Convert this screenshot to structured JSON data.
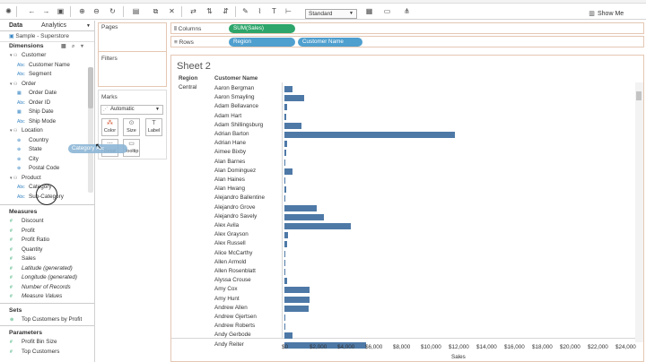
{
  "toolbar": {
    "icons": [
      "back-icon",
      "forward-icon",
      "save-icon",
      "new-datasource-icon",
      "pause-icon",
      "refresh-icon",
      "new-sheet-icon",
      "duplicate-icon",
      "clear-icon",
      "swap-icon",
      "sort-asc-icon",
      "sort-desc-icon",
      "highlight-icon",
      "group-icon",
      "label-icon",
      "fix-axes-icon",
      "fit-icon",
      "presentation-icon",
      "share-icon"
    ],
    "standard_label": "Standard",
    "show_me_label": "Show Me"
  },
  "left": {
    "tabs": {
      "data": "Data",
      "analytics": "Analytics"
    },
    "datasource": "Sample - Superstore",
    "dimensions_title": "Dimensions",
    "dimensions": [
      {
        "label": "Customer",
        "type": "folder"
      },
      {
        "label": "Customer Name",
        "type": "abc"
      },
      {
        "label": "Segment",
        "type": "abc"
      },
      {
        "label": "Order",
        "type": "folder"
      },
      {
        "label": "Order Date",
        "type": "date"
      },
      {
        "label": "Order ID",
        "type": "abc"
      },
      {
        "label": "Ship Date",
        "type": "date"
      },
      {
        "label": "Ship Mode",
        "type": "abc"
      },
      {
        "label": "Location",
        "type": "folder"
      },
      {
        "label": "Country",
        "type": "geo"
      },
      {
        "label": "State",
        "type": "geo"
      },
      {
        "label": "City",
        "type": "geo"
      },
      {
        "label": "Postal Code",
        "type": "geo"
      },
      {
        "label": "Product",
        "type": "folder"
      },
      {
        "label": "Category",
        "type": "abc"
      },
      {
        "label": "Sub-Category",
        "type": "abc"
      }
    ],
    "measures_title": "Measures",
    "measures": [
      {
        "label": "Discount",
        "italic": false
      },
      {
        "label": "Profit",
        "italic": false
      },
      {
        "label": "Profit Ratio",
        "italic": false
      },
      {
        "label": "Quantity",
        "italic": false
      },
      {
        "label": "Sales",
        "italic": false
      },
      {
        "label": "Latitude (generated)",
        "italic": true
      },
      {
        "label": "Longitude (generated)",
        "italic": true
      },
      {
        "label": "Number of Records",
        "italic": true
      },
      {
        "label": "Measure Values",
        "italic": true
      }
    ],
    "sets_title": "Sets",
    "sets": [
      "Top Customers by Profit"
    ],
    "parameters_title": "Parameters",
    "parameters": [
      "Profit Bin Size",
      "Top Customers"
    ]
  },
  "cards": {
    "pages": "Pages",
    "filters": "Filters",
    "marks": "Marks",
    "marks_type": "Automatic",
    "buttons": {
      "color": "Color",
      "size": "Size",
      "label": "Label",
      "detail": "Detail",
      "tooltip": "Tooltip"
    }
  },
  "shelves": {
    "columns_label": "Columns",
    "columns_pill": "SUM(Sales)",
    "rows_label": "Rows",
    "rows_pills": [
      "Region",
      "Customer Name"
    ]
  },
  "drag_pill": "Category",
  "sheet": {
    "title": "Sheet 2",
    "header_region": "Region",
    "header_customer": "Customer Name",
    "region_value": "Central"
  },
  "chart_data": {
    "type": "bar",
    "orientation": "horizontal",
    "xlabel": "Sales",
    "xlim": [
      0,
      24000
    ],
    "tick_labels": [
      "$0",
      "$2,000",
      "$4,000",
      "$6,000",
      "$8,000",
      "$10,000",
      "$12,000",
      "$14,000",
      "$16,000",
      "$18,000",
      "$20,000",
      "$22,000",
      "$24,000"
    ],
    "tick_values": [
      0,
      2000,
      4000,
      6000,
      8000,
      10000,
      12000,
      14000,
      16000,
      18000,
      20000,
      22000,
      24000
    ],
    "categories": [
      "Aaron Bergman",
      "Aaron Smayling",
      "Adam Bellavance",
      "Adam Hart",
      "Adam Shillingsburg",
      "Adrian Barton",
      "Adrian Hane",
      "Aimee Bixby",
      "Alan Barnes",
      "Alan Dominguez",
      "Alan Haines",
      "Alan Hwang",
      "Alejandro Ballentine",
      "Alejandro Grove",
      "Alejandro Savely",
      "Alex Avila",
      "Alex Grayson",
      "Alex Russell",
      "Alice McCarthy",
      "Allen Armold",
      "Allen Rosenblatt",
      "Alyssa Crouse",
      "Amy Cox",
      "Amy Hunt",
      "Andrew Allen",
      "Andrew Gjertsen",
      "Andrew Roberts",
      "Andy Gerbode",
      "Andy Reiter"
    ],
    "values": [
      560,
      1450,
      180,
      160,
      1200,
      12250,
      210,
      120,
      40,
      570,
      70,
      160,
      40,
      2350,
      2850,
      4800,
      280,
      170,
      90,
      70,
      80,
      170,
      1800,
      1800,
      1750,
      70,
      80,
      560,
      5900
    ]
  }
}
